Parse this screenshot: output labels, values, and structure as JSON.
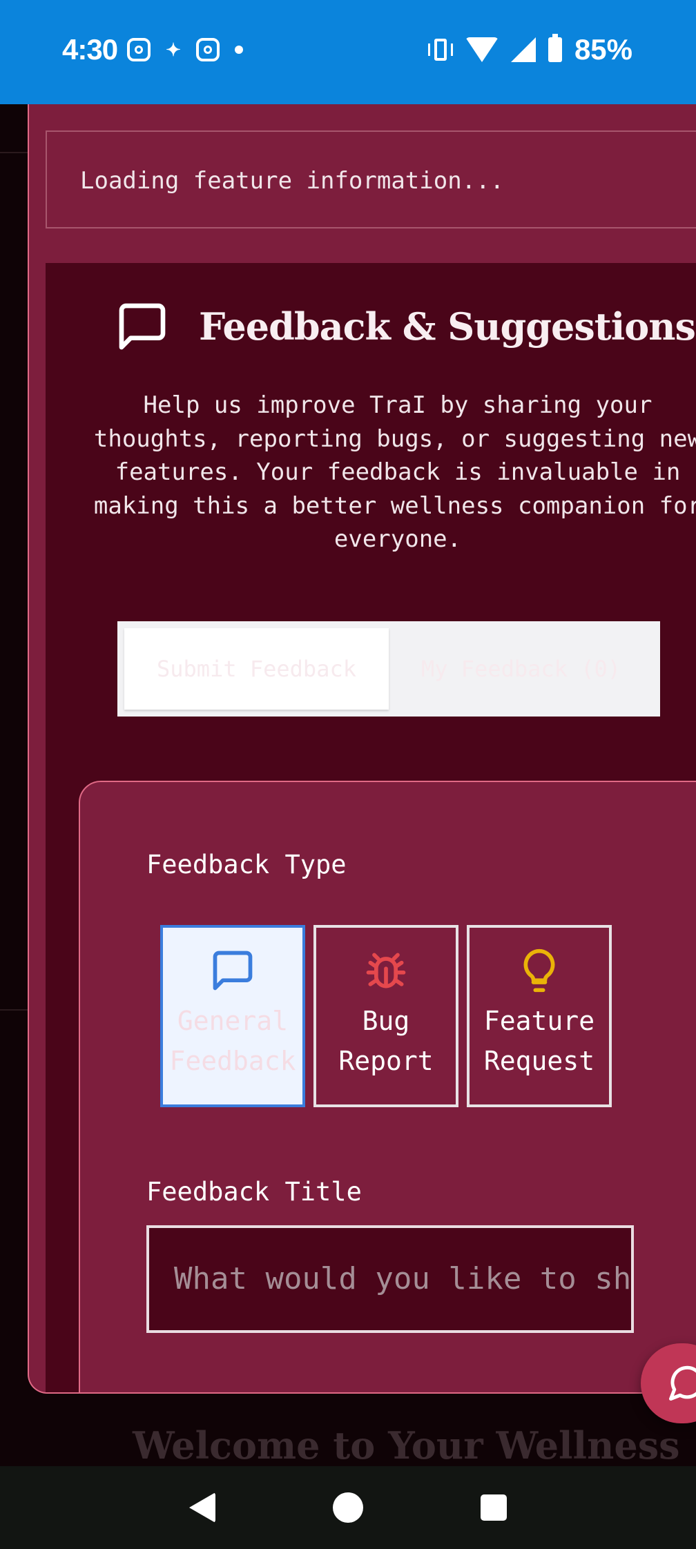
{
  "status_bar": {
    "time": "4:30",
    "battery": "85%"
  },
  "loading_text": "Loading feature information...",
  "feedback": {
    "title": "Feedback & Suggestions",
    "description": "Help us improve TraI by sharing your thoughts, reporting bugs, or suggesting new features. Your feedback is invaluable in making this a better wellness companion for everyone.",
    "tabs": [
      {
        "label": "Submit Feedback",
        "active": true
      },
      {
        "label": "My Feedback (0)",
        "active": false
      }
    ],
    "type_label": "Feedback Type",
    "types": [
      {
        "label": "General\nFeedback",
        "icon": "message-square-icon",
        "color": "#3b7ddd",
        "selected": true
      },
      {
        "label": "Bug\nReport",
        "icon": "bug-icon",
        "color": "#e5484d",
        "selected": false
      },
      {
        "label": "Feature\nRequest",
        "icon": "lightbulb-icon",
        "color": "#eab308",
        "selected": false
      }
    ],
    "title_field_label": "Feedback Title",
    "title_placeholder": "What would you like to share?"
  },
  "background_heading": "Welcome to Your Wellness",
  "colors": {
    "status_bar": "#0b84dc",
    "card": "#7d1e3d",
    "panel": "#4a0519",
    "accent_border": "#e06a86",
    "selected_blue": "#3b7ddd"
  }
}
